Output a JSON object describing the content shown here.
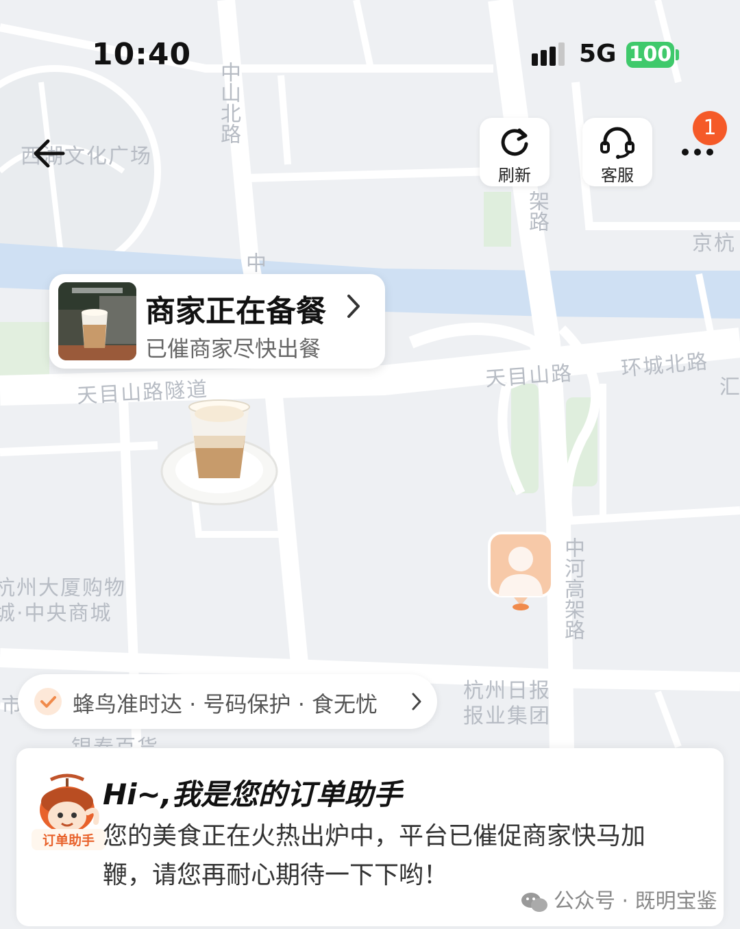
{
  "status_bar": {
    "time": "10:40",
    "network": "5G",
    "battery": "100"
  },
  "top_controls": {
    "refresh_label": "刷新",
    "service_label": "客服",
    "notification_count": "1"
  },
  "map_labels": {
    "west_lake_culture": "西湖文化广场",
    "zhongshan_north": "中山北路",
    "zhong": "中",
    "jia_lu": "架路",
    "jing_hang": "京杭",
    "tianmushan_tunnel": "天目山路隧道",
    "tianmushan_road": "天目山路",
    "huancheng_north": "环城北路",
    "hui": "汇",
    "hangzhou_mall": "杭州大厦购物\n城·中央商城",
    "zhonghe_viaduct": "中河高架路",
    "hangzhou_daily": "杭州日报\n报业集团",
    "yintai": "银泰百货",
    "shi": "市"
  },
  "order_status": {
    "title": "商家正在备餐",
    "subtitle": "已催商家尽快出餐"
  },
  "guarantee": {
    "text": "蜂鸟准时达 · 号码保护 · 食无忧"
  },
  "assistant": {
    "avatar_label": "订单助手",
    "title": "Hi~,我是您的订单助手",
    "message": "您的美食正在火热出炉中，平台已催促商家快马加鞭，请您再耐心期待一下下哟！"
  },
  "watermark": "公众号 · 既明宝鉴",
  "colors": {
    "accent_orange": "#f55a28",
    "battery_green": "#3fc96b",
    "river_blue": "#cfe0f3",
    "park_green": "#dfeedd"
  }
}
